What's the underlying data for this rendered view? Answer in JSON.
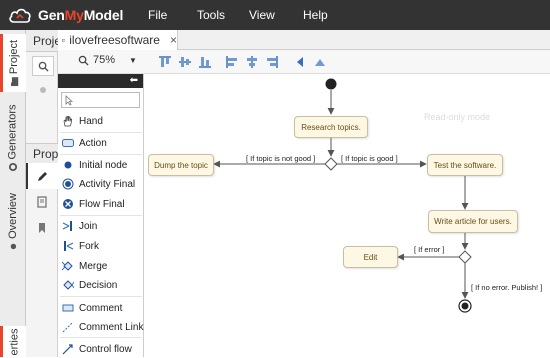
{
  "app": {
    "logo_text_a": "Gen",
    "logo_text_b": "My",
    "logo_text_c": "Model",
    "brand_color": "#e9452d",
    "topbar_color": "#333333"
  },
  "menu": {
    "file": "File",
    "tools": "Tools",
    "view": "View",
    "help": "Help"
  },
  "left_tabs": {
    "project": "Project",
    "generators": "Generators",
    "overview": "Overview",
    "properties": "erties"
  },
  "project_panel": {
    "tab_label": "Proje",
    "properties_tab": "Prope"
  },
  "editor": {
    "tab_title": "ilovefreesoftware",
    "close": "×",
    "watermark": "Read-only mode"
  },
  "toolbar": {
    "zoom": "75%"
  },
  "palette": {
    "collapse": "⬅",
    "items": [
      {
        "label": "Hand",
        "icon": "hand-icon"
      },
      {
        "label": "Action",
        "icon": "action-icon"
      },
      {
        "label": "Initial node",
        "icon": "initial-node-icon"
      },
      {
        "label": "Activity Final",
        "icon": "activity-final-icon"
      },
      {
        "label": "Flow Final",
        "icon": "flow-final-icon"
      },
      {
        "label": "Join",
        "icon": "join-icon"
      },
      {
        "label": "Fork",
        "icon": "fork-icon"
      },
      {
        "label": "Merge",
        "icon": "merge-icon"
      },
      {
        "label": "Decision",
        "icon": "decision-icon"
      },
      {
        "label": "Comment",
        "icon": "comment-icon"
      },
      {
        "label": "Comment Link",
        "icon": "comment-link-icon"
      },
      {
        "label": "Control flow",
        "icon": "control-flow-icon"
      }
    ]
  },
  "diagram": {
    "research": "Research topics.",
    "dump": "Dump the topic",
    "test": "Test the software.",
    "write": "Write article for users.",
    "edit": "Edit",
    "guard_not_good": "[ If topic is not good ]",
    "guard_good": "[ If topic is good ]",
    "guard_error": "[ If error ]",
    "guard_no_error": "[ If no error. Publish! ]"
  }
}
